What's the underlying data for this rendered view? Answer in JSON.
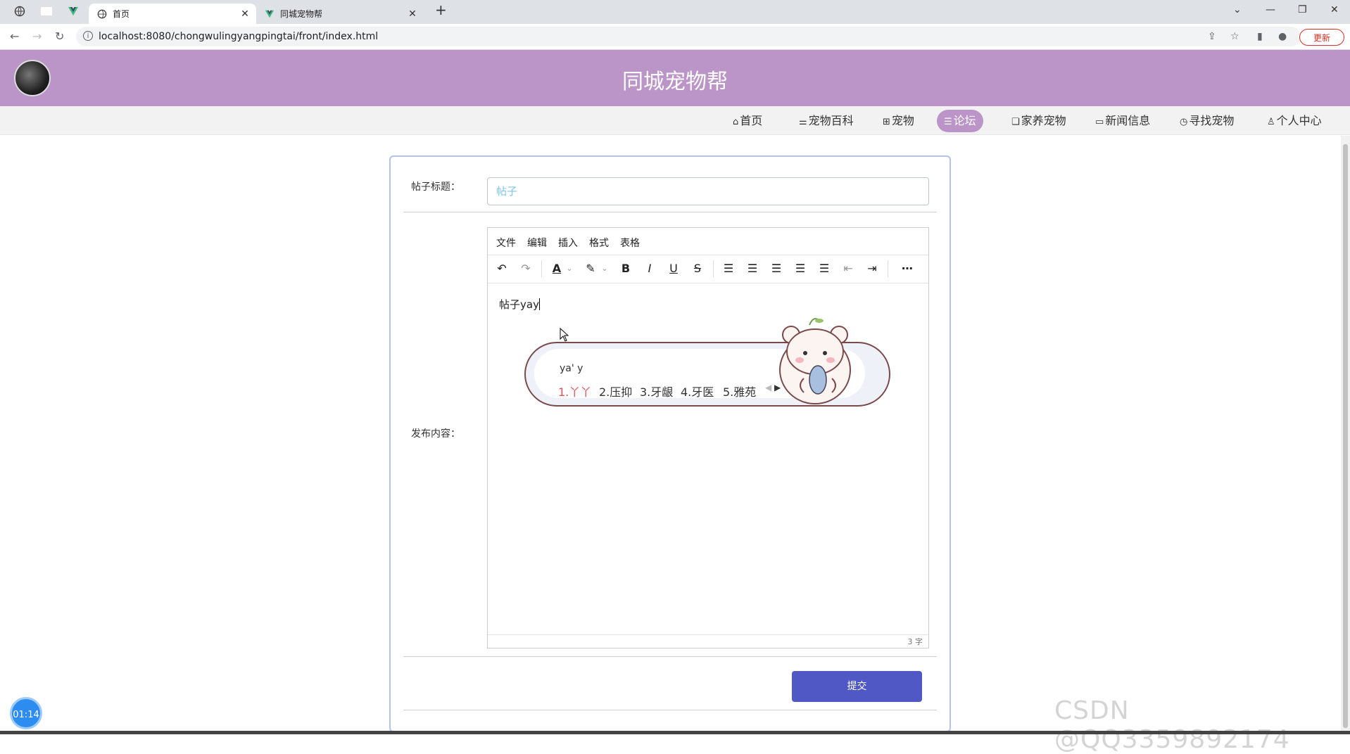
{
  "browser": {
    "tabs": [
      {
        "title": "首页"
      },
      {
        "title": "同城宠物帮"
      }
    ],
    "url": "localhost:8080/chongwulingyangpingtai/front/index.html",
    "update_label": "更新"
  },
  "site": {
    "title": "同城宠物帮"
  },
  "nav": {
    "items": [
      {
        "label": "首页",
        "icon": "home-icon"
      },
      {
        "label": "宠物百科",
        "icon": "sliders-icon"
      },
      {
        "label": "宠物",
        "icon": "grid-icon"
      },
      {
        "label": "论坛",
        "icon": "forum-icon",
        "active": true
      },
      {
        "label": "家养宠物",
        "icon": "layers-icon"
      },
      {
        "label": "新闻信息",
        "icon": "book-icon"
      },
      {
        "label": "寻找宠物",
        "icon": "clock-icon"
      },
      {
        "label": "个人中心",
        "icon": "user-icon"
      }
    ],
    "accent_color": "#bc95c8"
  },
  "form": {
    "title_label": "帖子标题：",
    "title_value": "帖子",
    "content_label": "发布内容：",
    "submit_label": "提交"
  },
  "editor": {
    "menu": [
      "文件",
      "编辑",
      "插入",
      "格式",
      "表格"
    ],
    "content_text": "帖子yay",
    "word_count": "3 字"
  },
  "ime": {
    "composition": "ya' y",
    "candidates": [
      "1.丫丫",
      "2.压抑",
      "3.牙龈",
      "4.牙医",
      "5.雅苑"
    ]
  },
  "overlay": {
    "timer": "01:14",
    "watermark": "CSDN @QQ3359892174"
  }
}
